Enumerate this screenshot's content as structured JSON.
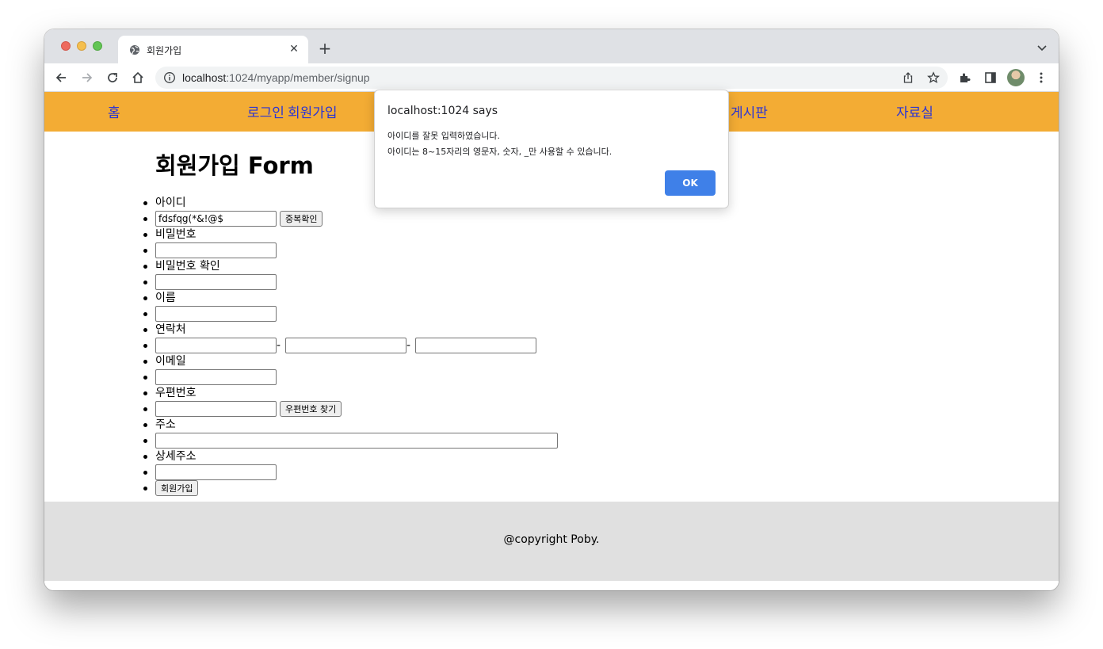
{
  "browser": {
    "tab_title": "회원가입",
    "url_host": "localhost",
    "url_rest": ":1024/myapp/member/signup"
  },
  "nav": {
    "items": [
      "홈",
      "로그인",
      "회원가입",
      "게시판",
      "자료실"
    ]
  },
  "form": {
    "heading": "회원가입 Form",
    "id_label": "아이디",
    "id_value": "fdsfqg(*&!@$",
    "dup_check_button": "중복확인",
    "pw_label": "비밀번호",
    "pw_confirm_label": "비밀번호 확인",
    "name_label": "이름",
    "phone_label": "연락처",
    "phone_sep": "-",
    "email_label": "이메일",
    "zip_label": "우편번호",
    "zip_button": "우편번호 찾기",
    "address_label": "주소",
    "detail_address_label": "상세주소",
    "submit_button": "회원가입"
  },
  "footer": {
    "text": "@copyright Poby."
  },
  "dialog": {
    "title": "localhost:1024 says",
    "line1": "아이디를 잘못 입력하였습니다.",
    "line2": "아이디는 8~15자리의 영문자, 숫자, _만 사용할 수 있습니다.",
    "ok": "OK"
  },
  "colors": {
    "nav_background": "#f3ac34",
    "nav_link": "#2a34d6",
    "footer_background": "#e0e0e0",
    "ok_button": "#3f80e8"
  }
}
